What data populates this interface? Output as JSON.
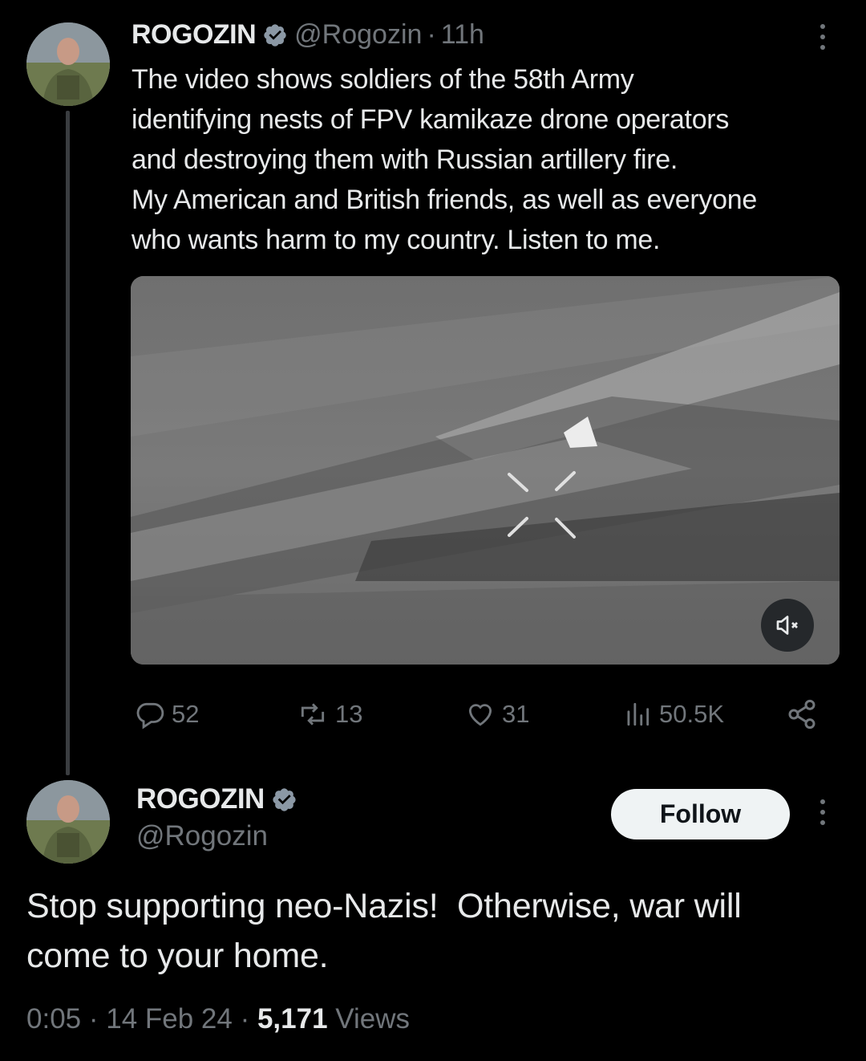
{
  "tweet": {
    "author_name": "ROGOZIN",
    "handle": "@Rogozin",
    "separator": "·",
    "time_ago": "11h",
    "text_lines": [
      "The video shows soldiers of the 58th Army",
      "identifying nests of FPV kamikaze drone operators",
      "and destroying them with Russian artillery fire.",
      "My American and British friends, as well as everyone",
      "who wants harm to my country. Listen to me."
    ],
    "actions": {
      "replies": "52",
      "retweets": "13",
      "likes": "31",
      "views": "50.5K"
    }
  },
  "quoted": {
    "author_name": "ROGOZIN",
    "handle": "@Rogozin",
    "follow_label": "Follow",
    "text_lines": [
      "Stop supporting neo-Nazis!  Otherwise, war will",
      "come to your home."
    ],
    "duration": "0:05",
    "sep1": " · ",
    "date": "14 Feb 24",
    "sep2": " · ",
    "views_count": "5,171",
    "views_label": " Views"
  },
  "icons": {
    "verified": "verified-badge-icon",
    "more": "more-vertical-icon",
    "mute": "volume-muted-icon",
    "reply": "reply-icon",
    "retweet": "retweet-icon",
    "like": "heart-icon",
    "views": "views-bar-icon",
    "share": "share-icon"
  },
  "colors": {
    "background": "#000000",
    "text": "#e7e9ea",
    "secondary": "#71767b",
    "verified": "#8b98a5",
    "follow_bg": "#eff3f4"
  }
}
